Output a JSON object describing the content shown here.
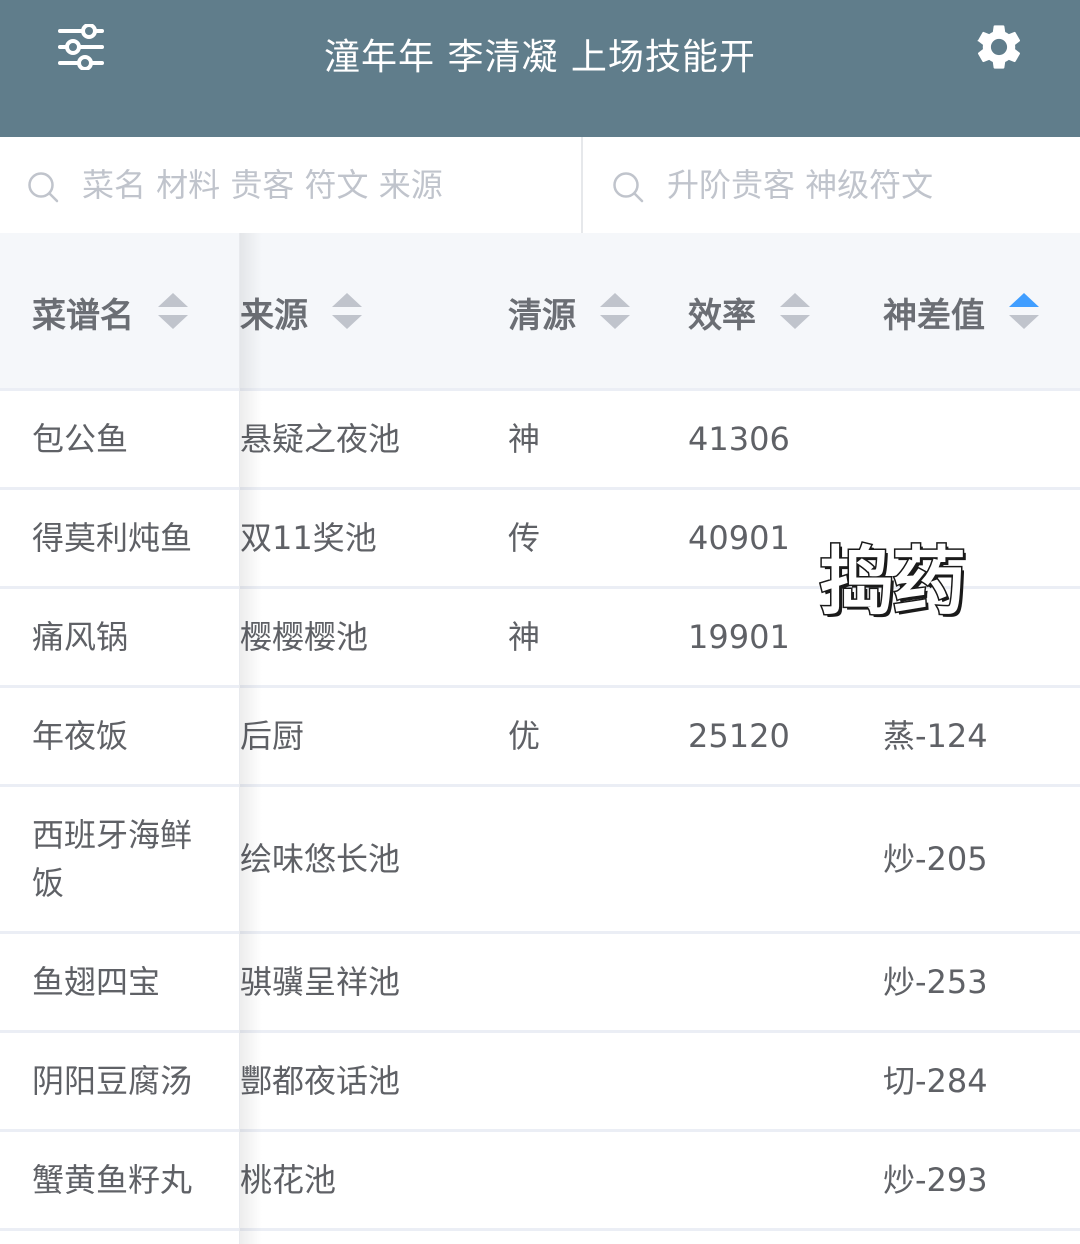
{
  "header": {
    "title": "潼年年 李清凝 上场技能开",
    "menu_icon": "filter-sliders-icon",
    "settings_icon": "gear-icon",
    "background_color": "#607d8b"
  },
  "search": {
    "left_placeholder": "菜名 材料 贵客 符文 来源",
    "left_value": "",
    "right_placeholder": "升阶贵客 神级符文",
    "right_value": ""
  },
  "table": {
    "columns": [
      {
        "label": "菜谱名",
        "sort": "none"
      },
      {
        "label": "来源",
        "sort": "none"
      },
      {
        "label": "清源",
        "sort": "none"
      },
      {
        "label": "效率",
        "sort": "none"
      },
      {
        "label": "神差值",
        "sort": "ascending"
      }
    ],
    "rows": [
      {
        "name": "包公鱼",
        "source": "悬疑之夜池",
        "quality": "神",
        "efficiency": "41306",
        "diff": ""
      },
      {
        "name": "得莫利炖鱼",
        "source": "双11奖池",
        "quality": "传",
        "efficiency": "40901",
        "diff": ""
      },
      {
        "name": "痛风锅",
        "source": "樱樱樱池",
        "quality": "神",
        "efficiency": "19901",
        "diff": ""
      },
      {
        "name": "年夜饭",
        "source": "后厨",
        "quality": "优",
        "efficiency": "25120",
        "diff": "蒸-124"
      },
      {
        "name": "西班牙海鲜饭",
        "source": "绘味悠长池",
        "quality": "",
        "efficiency": "",
        "diff": "炒-205"
      },
      {
        "name": "鱼翅四宝",
        "source": "骐骥呈祥池",
        "quality": "",
        "efficiency": "",
        "diff": "炒-253"
      },
      {
        "name": "阴阳豆腐汤",
        "source": "酆都夜话池",
        "quality": "",
        "efficiency": "",
        "diff": "切-284"
      },
      {
        "name": "蟹黄鱼籽丸",
        "source": "桃花池",
        "quality": "",
        "efficiency": "",
        "diff": "炒-293"
      }
    ]
  },
  "overlay": {
    "text": "捣药"
  },
  "colors": {
    "sort_active": "#409eff",
    "sort_inactive": "#c0c4cc",
    "header_row_bg": "#f5f7fa"
  }
}
